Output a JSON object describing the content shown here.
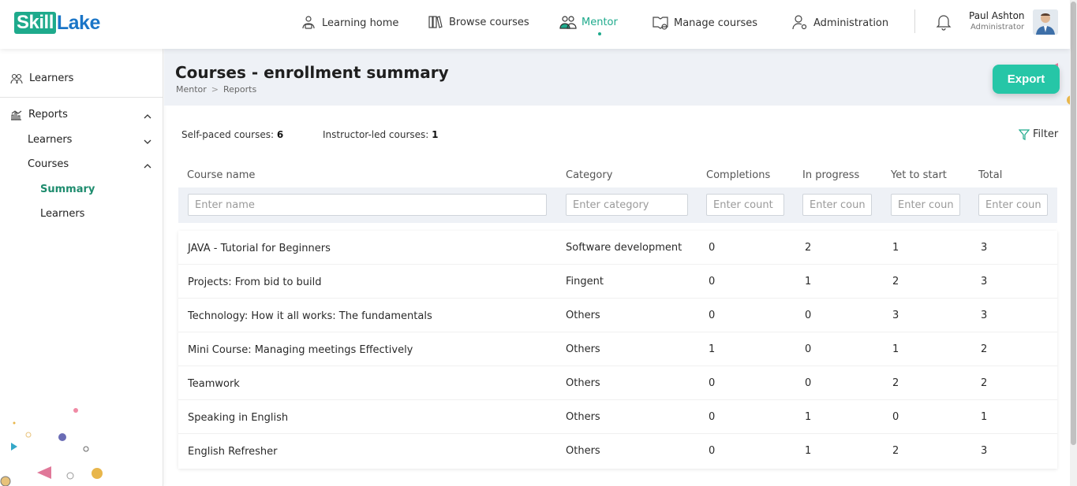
{
  "brand": {
    "logo_part1": "Skill",
    "logo_part2": "Lake"
  },
  "nav": [
    {
      "label": "Learning home",
      "icon": "learning-home-icon"
    },
    {
      "label": "Browse courses",
      "icon": "books-icon"
    },
    {
      "label": "Mentor",
      "icon": "mentor-icon",
      "active": true
    },
    {
      "label": "Manage courses",
      "icon": "manage-courses-icon"
    },
    {
      "label": "Administration",
      "icon": "admin-user-icon"
    }
  ],
  "user": {
    "name": "Paul Ashton",
    "role": "Administrator"
  },
  "sidebar": {
    "learners": "Learners",
    "reports": "Reports",
    "reports_learners": "Learners",
    "courses": "Courses",
    "summary": "Summary",
    "courses_learners": "Learners"
  },
  "page": {
    "title": "Courses - enrollment summary",
    "breadcrumb": [
      "Mentor",
      "Reports"
    ],
    "export_label": "Export",
    "filter_label": "Filter",
    "self_paced_label": "Self-paced courses:",
    "self_paced_count": "6",
    "instructor_led_label": "Instructor-led courses:",
    "instructor_led_count": "1"
  },
  "table": {
    "headers": [
      "Course name",
      "Category",
      "Completions",
      "In progress",
      "Yet to start",
      "Total"
    ],
    "placeholders": [
      "Enter name",
      "Enter category",
      "Enter count",
      "Enter count",
      "Enter count",
      "Enter count"
    ],
    "rows": [
      [
        "JAVA - Tutorial for Beginners",
        "Software development",
        "0",
        "2",
        "1",
        "3"
      ],
      [
        "Projects: From bid to build",
        "Fingent",
        "0",
        "1",
        "2",
        "3"
      ],
      [
        "Technology: How it all works: The fundamentals",
        "Others",
        "0",
        "0",
        "3",
        "3"
      ],
      [
        "Mini Course: Managing meetings Effectively",
        "Others",
        "1",
        "0",
        "1",
        "2"
      ],
      [
        "Teamwork",
        "Others",
        "0",
        "0",
        "2",
        "2"
      ],
      [
        "Speaking in English",
        "Others",
        "0",
        "1",
        "0",
        "1"
      ],
      [
        "English Refresher",
        "Others",
        "0",
        "1",
        "2",
        "3"
      ]
    ]
  },
  "colors": {
    "accent": "#1eaa8c",
    "export": "#26c6a7",
    "brand_blue": "#1a75c7",
    "header_bg": "#eef1f6"
  }
}
